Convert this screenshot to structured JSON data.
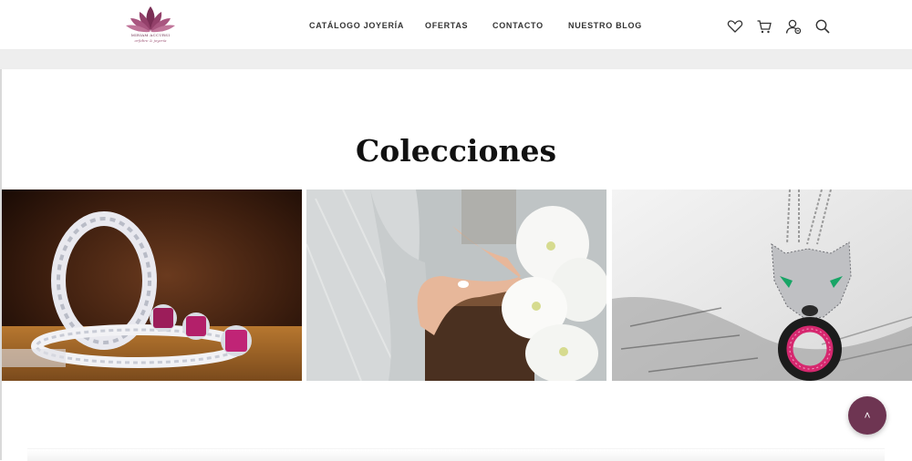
{
  "brand": {
    "name": "MIRIAM ACCURSI",
    "tagline": "orfebre & joyería",
    "color": "#6e3552"
  },
  "nav": {
    "items": [
      {
        "label": "CATÁLOGO JOYERÍA"
      },
      {
        "label": "OFERTAS"
      },
      {
        "label": "CONTACTO"
      },
      {
        "label": "NUESTRO BLOG"
      }
    ]
  },
  "header_icons": [
    "heart-icon",
    "cart-icon",
    "user-icon",
    "search-icon"
  ],
  "section": {
    "title": "Colecciones"
  },
  "collections": [
    {
      "name": "rings-collection-image"
    },
    {
      "name": "bridal-collection-image"
    },
    {
      "name": "panther-pendant-collection-image"
    }
  ],
  "back_to_top": {
    "icon": "chevron-up-icon",
    "glyph": "˄"
  }
}
